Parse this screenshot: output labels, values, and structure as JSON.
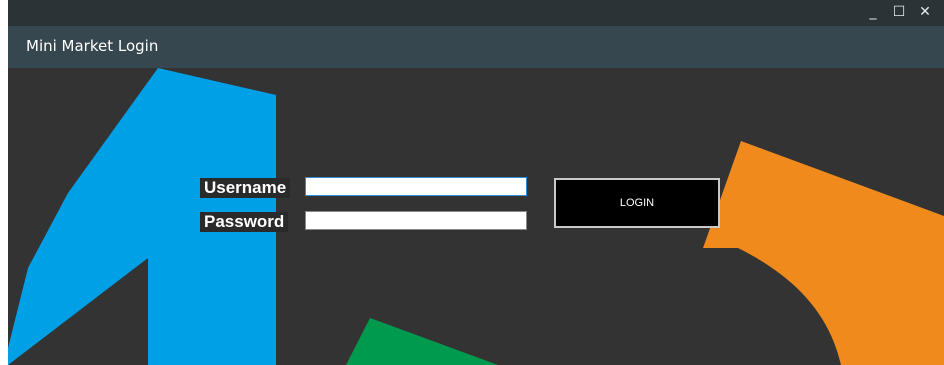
{
  "window": {
    "controls": {
      "minimize": "_",
      "maximize": "☐",
      "close": "✕"
    }
  },
  "header": {
    "title": "Mini Market Login"
  },
  "form": {
    "username_label": "Username",
    "password_label": "Password",
    "username_value": "",
    "password_value": "",
    "login_label": "LOGIN"
  },
  "colors": {
    "background": "#333333",
    "header": "#37474f",
    "titlebar": "#2b3337",
    "blue_shape": "#00a0e6",
    "orange_shape": "#f08a1c",
    "green_shape": "#009a4e"
  }
}
